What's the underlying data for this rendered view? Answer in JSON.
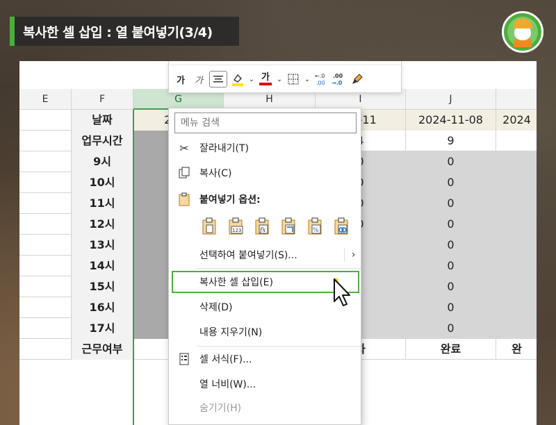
{
  "title": "복사한 셀 삽입 : 열 붙여넣기(3/4)",
  "toolbar": {
    "bold_label": "가",
    "italic_label": "가",
    "font_color_label": "가",
    "dec_increase": "←.0\n.00",
    "dec_decrease": ".00\n→.0"
  },
  "columns": [
    "E",
    "F",
    "G",
    "H",
    "I",
    "J",
    ""
  ],
  "rows": [
    {
      "label": "날짜",
      "g": "2024",
      "i": "11-11",
      "j": "2024-11-08",
      "k": "2024"
    },
    {
      "label": "업무시간",
      "g": "",
      "i": "4",
      "j": "9",
      "k": ""
    },
    {
      "label": "9시",
      "g": "",
      "i": "0",
      "j": "0",
      "k": ""
    },
    {
      "label": "10시",
      "g": "",
      "i": "0",
      "j": "0",
      "k": ""
    },
    {
      "label": "11시",
      "g": "",
      "i": "0",
      "j": "0",
      "k": ""
    },
    {
      "label": "12시",
      "g": "",
      "i": "0",
      "j": "0",
      "k": ""
    },
    {
      "label": "13시",
      "g": "",
      "i": "",
      "j": "0",
      "k": ""
    },
    {
      "label": "14시",
      "g": "",
      "i": "",
      "j": "0",
      "k": ""
    },
    {
      "label": "15시",
      "g": "",
      "i": "",
      "j": "0",
      "k": ""
    },
    {
      "label": "16시",
      "g": "",
      "i": "",
      "j": "0",
      "k": ""
    },
    {
      "label": "17시",
      "g": "",
      "i": "",
      "j": "0",
      "k": ""
    },
    {
      "label": "근무여부",
      "g": "",
      "i": "차",
      "j": "완료",
      "k": "완"
    }
  ],
  "menu": {
    "search_placeholder": "메뉴 검색",
    "cut": "잘라내기(T)",
    "copy": "복사(C)",
    "paste_options": "붙여넣기 옵션:",
    "paste_special": "선택하여 붙여넣기(S)...",
    "insert_copied": "복사한 셀 삽입(E)",
    "delete": "삭제(D)",
    "clear": "내용 지우기(N)",
    "format_cells": "셀 서식(F)...",
    "column_width": "열 너비(W)...",
    "hide": "숨기기(H)",
    "paste_icon_numbers": "123"
  },
  "colors": {
    "accent": "#4cae3a",
    "selected_header": "#cfe5d2",
    "highlight_yellow": "#ffe600",
    "font_red": "#e00000"
  }
}
